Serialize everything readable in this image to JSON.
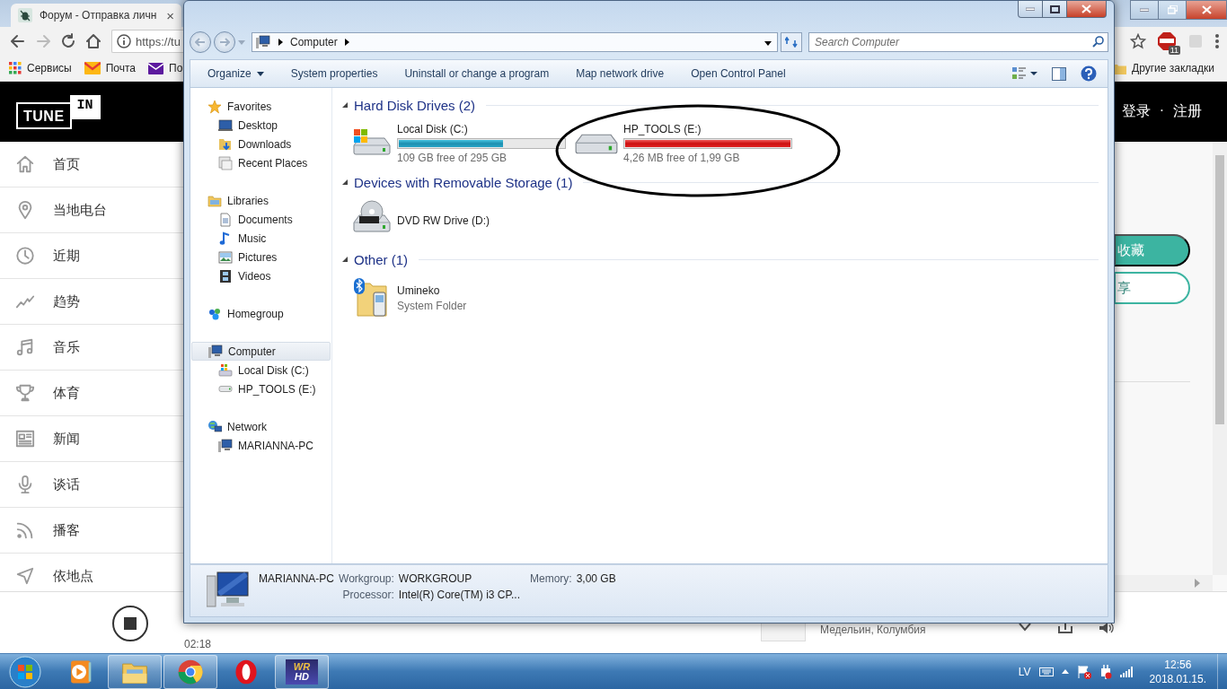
{
  "browser": {
    "tab": {
      "title": "Форум - Отправка личн",
      "close": "×"
    },
    "address": "https://tu",
    "bookmarks": [
      {
        "label": "Сервисы",
        "kind": "apps"
      },
      {
        "label": "Почта",
        "kind": "mail"
      },
      {
        "label": "По",
        "kind": "envelope"
      }
    ],
    "other_bookmarks": "Другие закладки",
    "abp_badge": "11"
  },
  "tunein": {
    "logo": {
      "left": "TUNE",
      "right": "IN"
    },
    "login": "登录",
    "separator": "·",
    "register": "注册",
    "nav": [
      {
        "label": "首页",
        "kind": "home"
      },
      {
        "label": "当地电台",
        "kind": "local"
      },
      {
        "label": "近期",
        "kind": "recent"
      },
      {
        "label": "趋势",
        "kind": "trending"
      },
      {
        "label": "音乐",
        "kind": "music"
      },
      {
        "label": "体育",
        "kind": "sports"
      },
      {
        "label": "新闻",
        "kind": "news"
      },
      {
        "label": "谈话",
        "kind": "talk"
      },
      {
        "label": "播客",
        "kind": "podcast"
      },
      {
        "label": "依地点",
        "kind": "location"
      }
    ],
    "buttons": [
      {
        "label": "收藏",
        "kind": "filled"
      },
      {
        "label": "享",
        "kind": "outline"
      }
    ],
    "player": {
      "time": "02:18",
      "station": "Медельин, Колумбия"
    }
  },
  "explorer": {
    "breadcrumb": "Computer",
    "search": {
      "placeholder": "Search Computer"
    },
    "toolbar": [
      {
        "label": "Organize",
        "kind": "menu"
      },
      {
        "label": "System properties",
        "kind": "command"
      },
      {
        "label": "Uninstall or change a program",
        "kind": "command"
      },
      {
        "label": "Map network drive",
        "kind": "command"
      },
      {
        "label": "Open Control Panel",
        "kind": "command"
      }
    ],
    "nav": [
      {
        "label": "Favorites",
        "kind": "star",
        "selected": false,
        "children": [
          {
            "label": "Desktop",
            "kind": "desktop",
            "selected": false
          },
          {
            "label": "Downloads",
            "kind": "downloads",
            "selected": false
          },
          {
            "label": "Recent Places",
            "kind": "recent",
            "selected": false
          }
        ]
      },
      {
        "label": "Libraries",
        "kind": "libraries",
        "selected": false,
        "children": [
          {
            "label": "Documents",
            "kind": "documents",
            "selected": false
          },
          {
            "label": "Music",
            "kind": "music",
            "selected": false
          },
          {
            "label": "Pictures",
            "kind": "pictures",
            "selected": false
          },
          {
            "label": "Videos",
            "kind": "videos",
            "selected": false
          }
        ]
      },
      {
        "label": "Homegroup",
        "kind": "homegroup",
        "selected": false
      },
      {
        "label": "Computer",
        "kind": "computer",
        "selected": true,
        "children": [
          {
            "label": "Local Disk (C:)",
            "kind": "system_drive",
            "selected": false
          },
          {
            "label": "HP_TOOLS (E:)",
            "kind": "drive",
            "selected": false
          }
        ]
      },
      {
        "label": "Network",
        "kind": "network",
        "selected": false,
        "children": [
          {
            "label": "MARIANNA-PC",
            "kind": "computer",
            "selected": false
          }
        ]
      }
    ],
    "groups": [
      {
        "title": "Hard Disk Drives (2)",
        "expanded": true,
        "items": [
          {
            "name": "Local Disk (C:)",
            "kind": "system_drive",
            "level": 0.63,
            "low_space": false,
            "detail": "109 GB free of 295 GB"
          },
          {
            "name": "HP_TOOLS (E:)",
            "kind": "drive",
            "level": 1,
            "low_space": true,
            "detail": "4,26 MB free of 1,99 GB"
          }
        ]
      },
      {
        "title": "Devices with Removable Storage (1)",
        "expanded": true,
        "items": [
          {
            "name": "DVD RW Drive (D:)",
            "kind": "dvd"
          }
        ]
      },
      {
        "title": "Other (1)",
        "expanded": true,
        "items": [
          {
            "name": "Umineko",
            "kind": "bluetooth",
            "detail": "System Folder"
          }
        ]
      }
    ],
    "details": {
      "name": "MARIANNA-PC",
      "fields": [
        {
          "label": "Workgroup:",
          "value": "WORKGROUP"
        },
        {
          "label": "Memory:",
          "value": "3,00 GB"
        },
        {
          "label": "Processor:",
          "value": "Intel(R) Core(TM) i3 CP..."
        }
      ]
    }
  },
  "taskbar": {
    "apps": [
      {
        "kind": "media_player",
        "running": false
      },
      {
        "kind": "explorer",
        "running": true
      },
      {
        "kind": "chrome",
        "running": true
      },
      {
        "kind": "opera",
        "running": false
      },
      {
        "kind": "wr_hd",
        "running": true,
        "text": [
          "WR",
          "HD"
        ]
      }
    ],
    "language": "LV",
    "time": "12:56",
    "date": "2018.01.15."
  }
}
